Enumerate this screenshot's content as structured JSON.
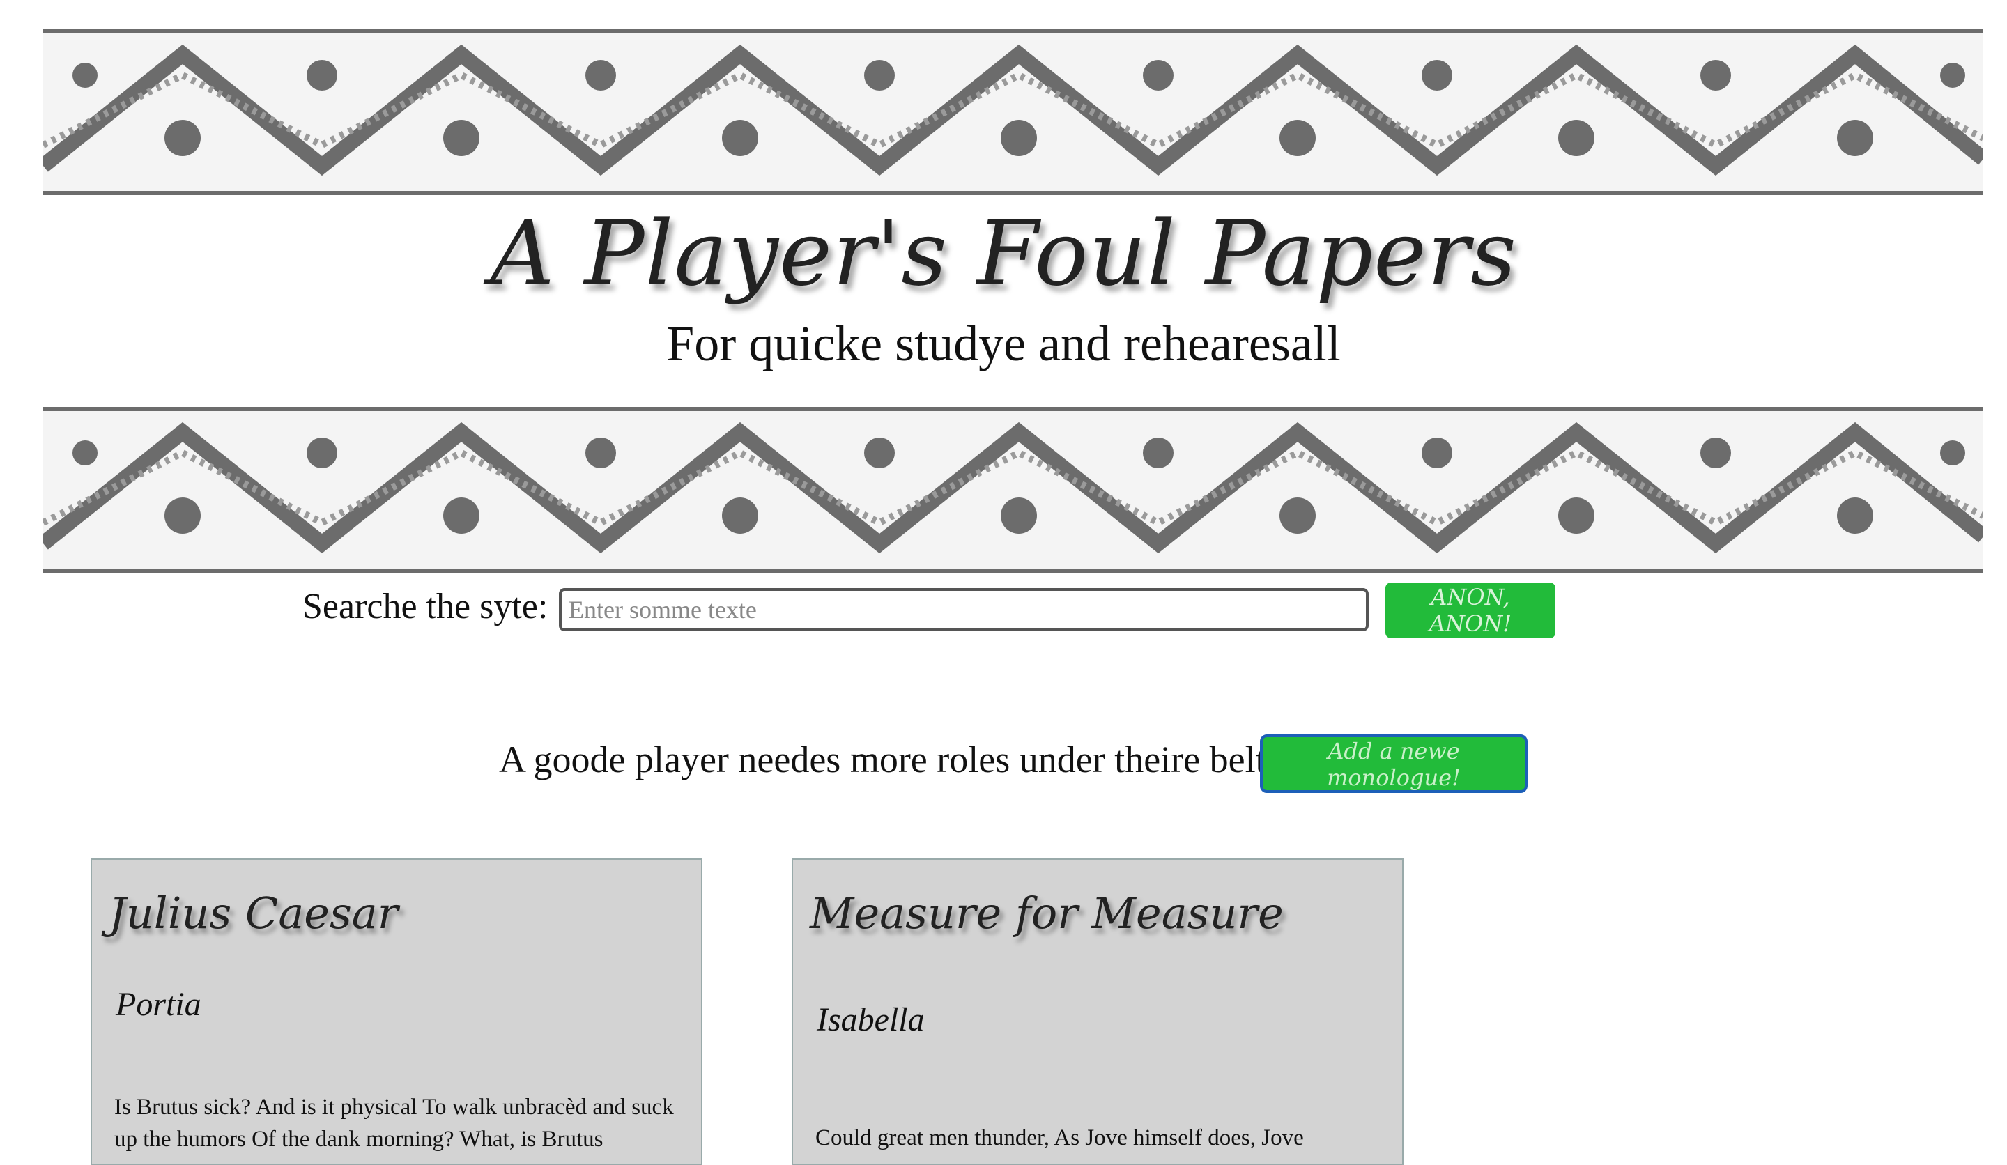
{
  "header": {
    "title": "A Player's Foul Papers",
    "subtitle": "For quicke studye and rehearesall"
  },
  "search": {
    "label": "Searche the syte:",
    "placeholder": "Enter somme texte",
    "value": "",
    "button_label": "ANON, ANON!"
  },
  "cta": {
    "text": "A goode player needes more roles under theire belte!",
    "button_label": "Add a newe monologue!"
  },
  "cards": [
    {
      "play": "Julius Caesar",
      "role": "Portia",
      "excerpt": "Is Brutus sick? And is it physical To walk unbracèd and suck up the humors Of the dank morning? What, is Brutus"
    },
    {
      "play": "Measure for Measure",
      "role": "Isabella",
      "excerpt": "Could great men thunder, As Jove himself does, Jove"
    }
  ],
  "colors": {
    "button_green": "#22bb3a",
    "card_bg": "#d3d3d3",
    "ornament_gray": "#6c6c6c"
  },
  "icons": [
    "ornamental-border-top",
    "ornamental-border-bottom"
  ]
}
